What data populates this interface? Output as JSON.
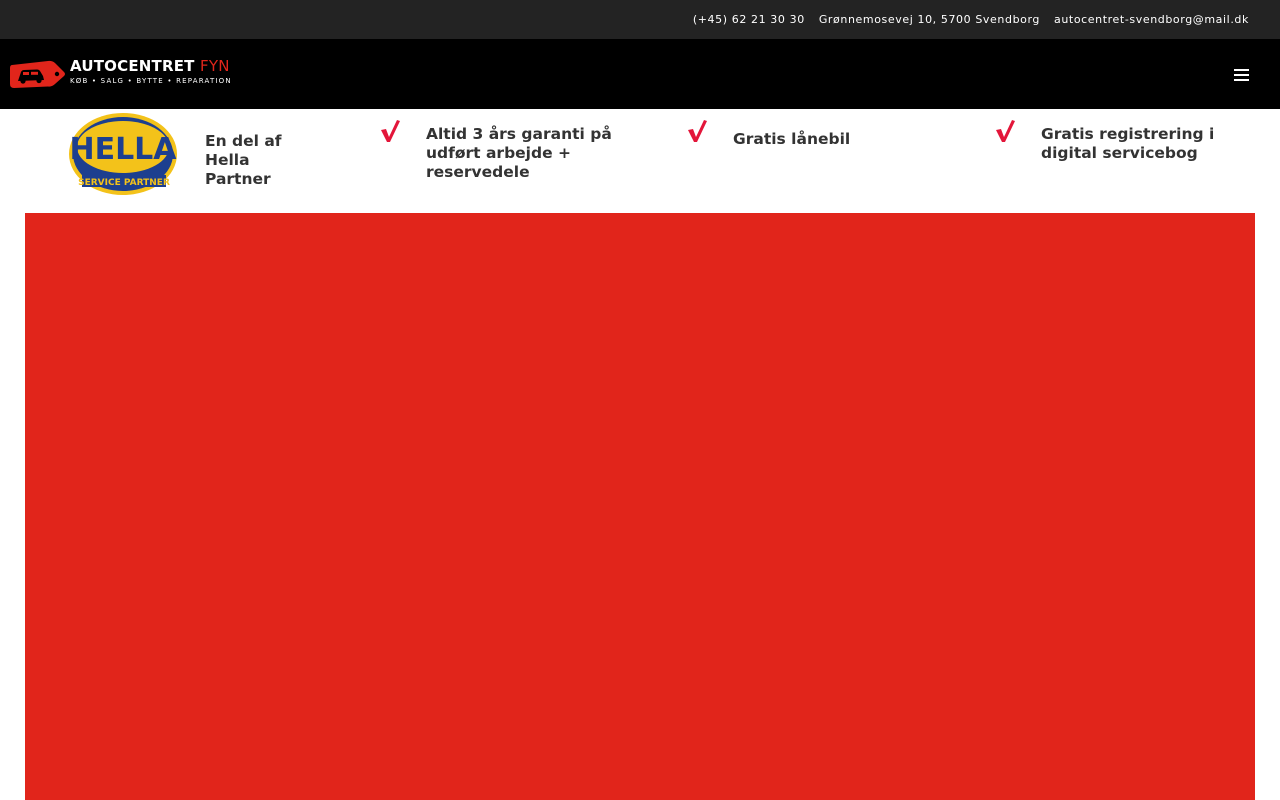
{
  "topbar": {
    "phone": "(+45) 62 21 30 30",
    "address": "Grønnemosevej 10, 5700 Svendborg",
    "email": "autocentret-svendborg@mail.dk"
  },
  "header": {
    "logo": {
      "brand_main": "AUTOCENTRET",
      "brand_accent": "FYN",
      "tagline": "KØB • SALG • BYTTE • REPARATION",
      "icon": "car-price-tag-icon"
    },
    "menu_icon": "hamburger-menu-icon"
  },
  "usps": {
    "hella": {
      "badge_top": "HELLA",
      "badge_bottom": "SERVICE PARTNER",
      "line1": "En del af",
      "line2": "Hella",
      "line3": "Partner"
    },
    "items": [
      {
        "icon": "checkmark-icon",
        "line1": "Altid 3 års garanti på",
        "line2": "udført arbejde +",
        "line3": "reservedele"
      },
      {
        "icon": "checkmark-icon",
        "line1": "Gratis lånebil"
      },
      {
        "icon": "checkmark-icon",
        "line1": "Gratis registrering i",
        "line2": "digital servicebog"
      }
    ]
  },
  "colors": {
    "topbar_bg": "#232323",
    "header_bg": "#000000",
    "brand_red": "#e1251b",
    "check_red": "#e3163a",
    "hella_yellow": "#f3c21a",
    "hella_blue": "#1d3f8f",
    "text_dark": "#333333"
  }
}
